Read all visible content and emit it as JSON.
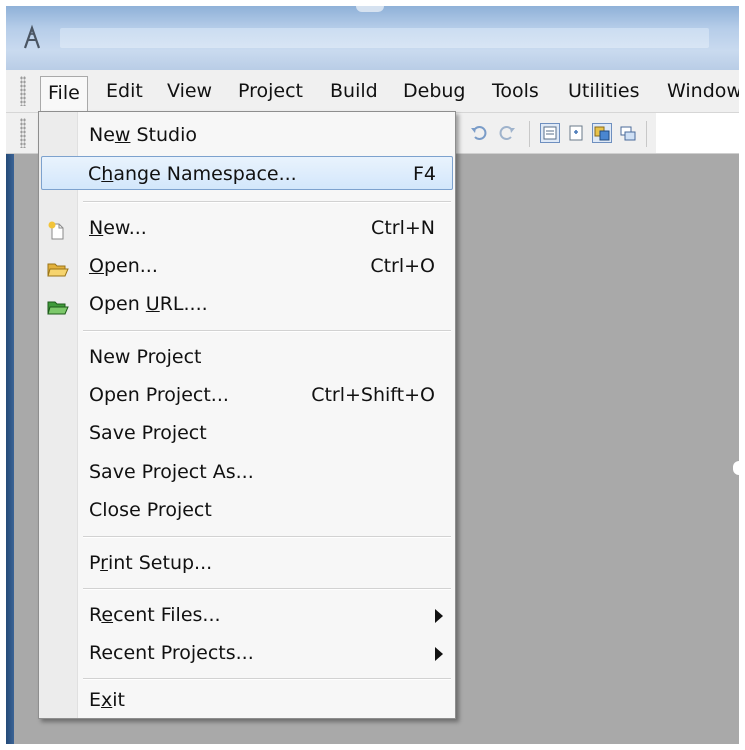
{
  "window": {
    "app_icon": "app-logo-icon"
  },
  "menubar": {
    "items": [
      {
        "label": "File",
        "active": true
      },
      {
        "label": "Edit"
      },
      {
        "label": "View"
      },
      {
        "label": "Project"
      },
      {
        "label": "Build"
      },
      {
        "label": "Debug"
      },
      {
        "label": "Tools"
      },
      {
        "label": "Utilities"
      },
      {
        "label": "Window"
      }
    ]
  },
  "toolbar": {
    "icons": [
      "undo-icon",
      "redo-icon",
      "class-view-icon",
      "namespace-view-icon",
      "inspector-icon",
      "output-window-icon"
    ]
  },
  "file_menu": {
    "items": [
      {
        "pre": "Ne",
        "u": "w",
        "post": " Studio",
        "shortcut": ""
      },
      {
        "pre": "C",
        "u": "h",
        "post": "ange Namespace...",
        "shortcut": "F4"
      },
      {
        "pre": "",
        "u": "N",
        "post": "ew...",
        "shortcut": "Ctrl+N",
        "icon": "new-file-icon"
      },
      {
        "pre": "",
        "u": "O",
        "post": "pen...",
        "shortcut": "Ctrl+O",
        "icon": "open-folder-icon"
      },
      {
        "pre": "Open ",
        "u": "U",
        "post": "RL....",
        "shortcut": "",
        "icon": "open-url-icon"
      },
      {
        "pre": "New Project",
        "u": "",
        "post": "",
        "shortcut": ""
      },
      {
        "pre": "Open Project...",
        "u": "",
        "post": "",
        "shortcut": "Ctrl+Shift+O"
      },
      {
        "pre": "Save Project",
        "u": "",
        "post": "",
        "shortcut": ""
      },
      {
        "pre": "Save Project As...",
        "u": "",
        "post": "",
        "shortcut": ""
      },
      {
        "pre": "Close Project",
        "u": "",
        "post": "",
        "shortcut": ""
      },
      {
        "pre": "P",
        "u": "r",
        "post": "int Setup...",
        "shortcut": ""
      },
      {
        "pre": "R",
        "u": "e",
        "post": "cent Files...",
        "shortcut": ""
      },
      {
        "pre": "Recent Projects...",
        "u": "",
        "post": "",
        "shortcut": ""
      },
      {
        "pre": "E",
        "u": "x",
        "post": "it",
        "shortcut": ""
      }
    ]
  },
  "colors": {
    "highlight_border": "#7da2ce",
    "workspace": "#a9a9a9",
    "window_frame": "#1f3f66"
  }
}
